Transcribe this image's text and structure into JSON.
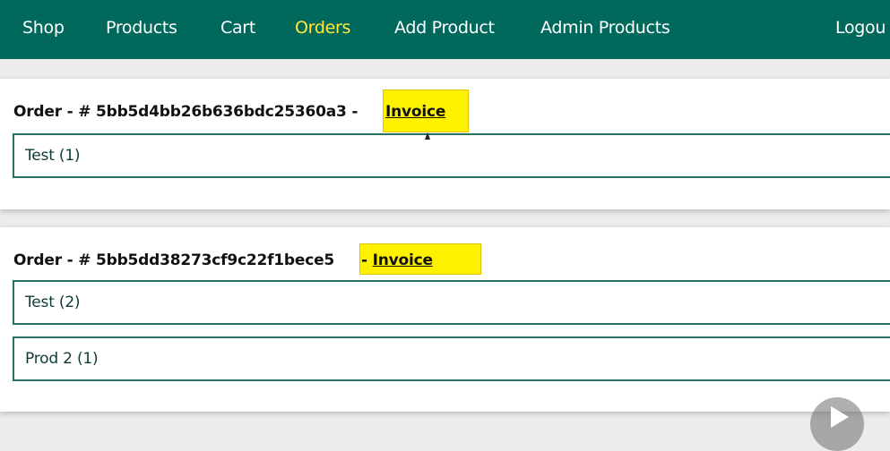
{
  "nav": {
    "items": [
      {
        "label": "Shop",
        "active": false
      },
      {
        "label": "Products",
        "active": false
      },
      {
        "label": "Cart",
        "active": false
      },
      {
        "label": "Orders",
        "active": true
      },
      {
        "label": "Add Product",
        "active": false
      },
      {
        "label": "Admin Products",
        "active": false
      }
    ],
    "logout_label": "Logou",
    "bg_color": "#00695c",
    "active_color": "#ffeb3b"
  },
  "orders": [
    {
      "header": "Order - # 5bb5d4bb26b636bdc25360a3 -",
      "invoice_label": "Invoice",
      "items": [
        {
          "label": "Test (1)"
        }
      ]
    },
    {
      "header": "Order - # 5bb5dd38273cf9c22f1bece5",
      "invoice_label": "- Invoice",
      "items": [
        {
          "label": "Test (2)"
        },
        {
          "label": "Prod 2 (1)"
        }
      ]
    }
  ],
  "highlight_color": "#fff200",
  "icons": {
    "cursor": "mouse-cursor-icon",
    "play": "play-icon"
  }
}
